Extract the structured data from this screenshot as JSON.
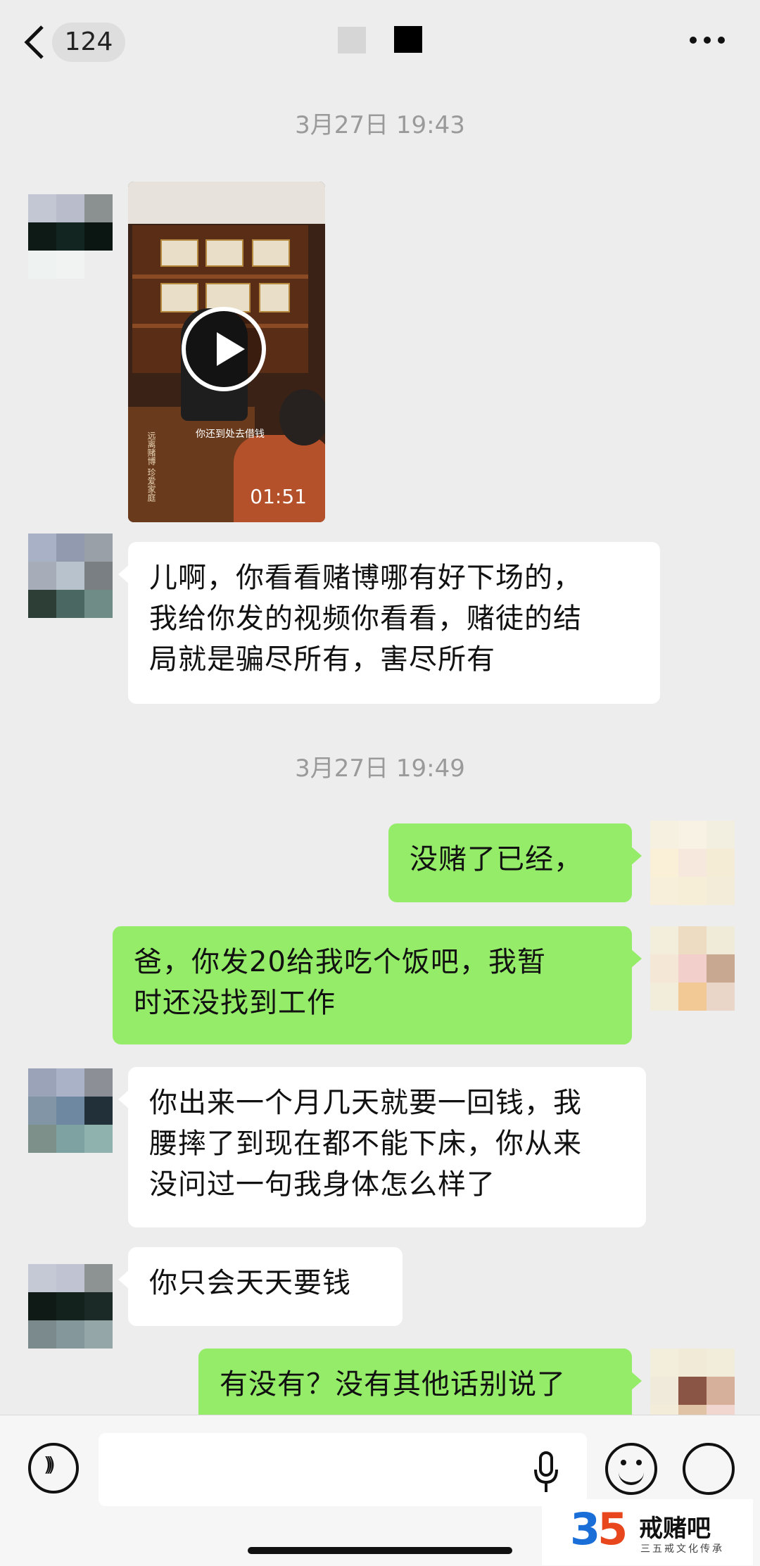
{
  "header": {
    "unread_count": "124"
  },
  "messages": [
    {
      "type": "time",
      "text": "3月27日 19:43"
    },
    {
      "type": "video",
      "side": "left",
      "caption": "你还到处去借钱",
      "side_text": "远离赌博 珍爱家庭",
      "duration": "01:51"
    },
    {
      "type": "text",
      "side": "left",
      "text": "儿啊，你看看赌博哪有好下场的，\n我给你发的视频你看看，赌徒的结\n局就是骗尽所有，害尽所有"
    },
    {
      "type": "time",
      "text": "3月27日 19:49"
    },
    {
      "type": "text",
      "side": "right",
      "text": "没赌了已经，"
    },
    {
      "type": "text",
      "side": "right",
      "text": "爸，你发20给我吃个饭吧，我暂\n时还没找到工作"
    },
    {
      "type": "text",
      "side": "left",
      "text": "你出来一个月几天就要一回钱，我\n腰摔了到现在都不能下床，你从来\n没问过一句我身体怎么样了"
    },
    {
      "type": "text",
      "side": "left",
      "text": "你只会天天要钱"
    },
    {
      "type": "text",
      "side": "right",
      "text": "有没有？没有其他话别说了"
    }
  ],
  "input": {
    "value": ""
  },
  "watermark": {
    "number_a": "3",
    "number_b": "5",
    "name": "戒赌吧",
    "sub": "三五戒文化传承"
  },
  "colors": {
    "background": "#ededed",
    "bubble_self": "#95ec69",
    "bubble_other": "#ffffff"
  }
}
